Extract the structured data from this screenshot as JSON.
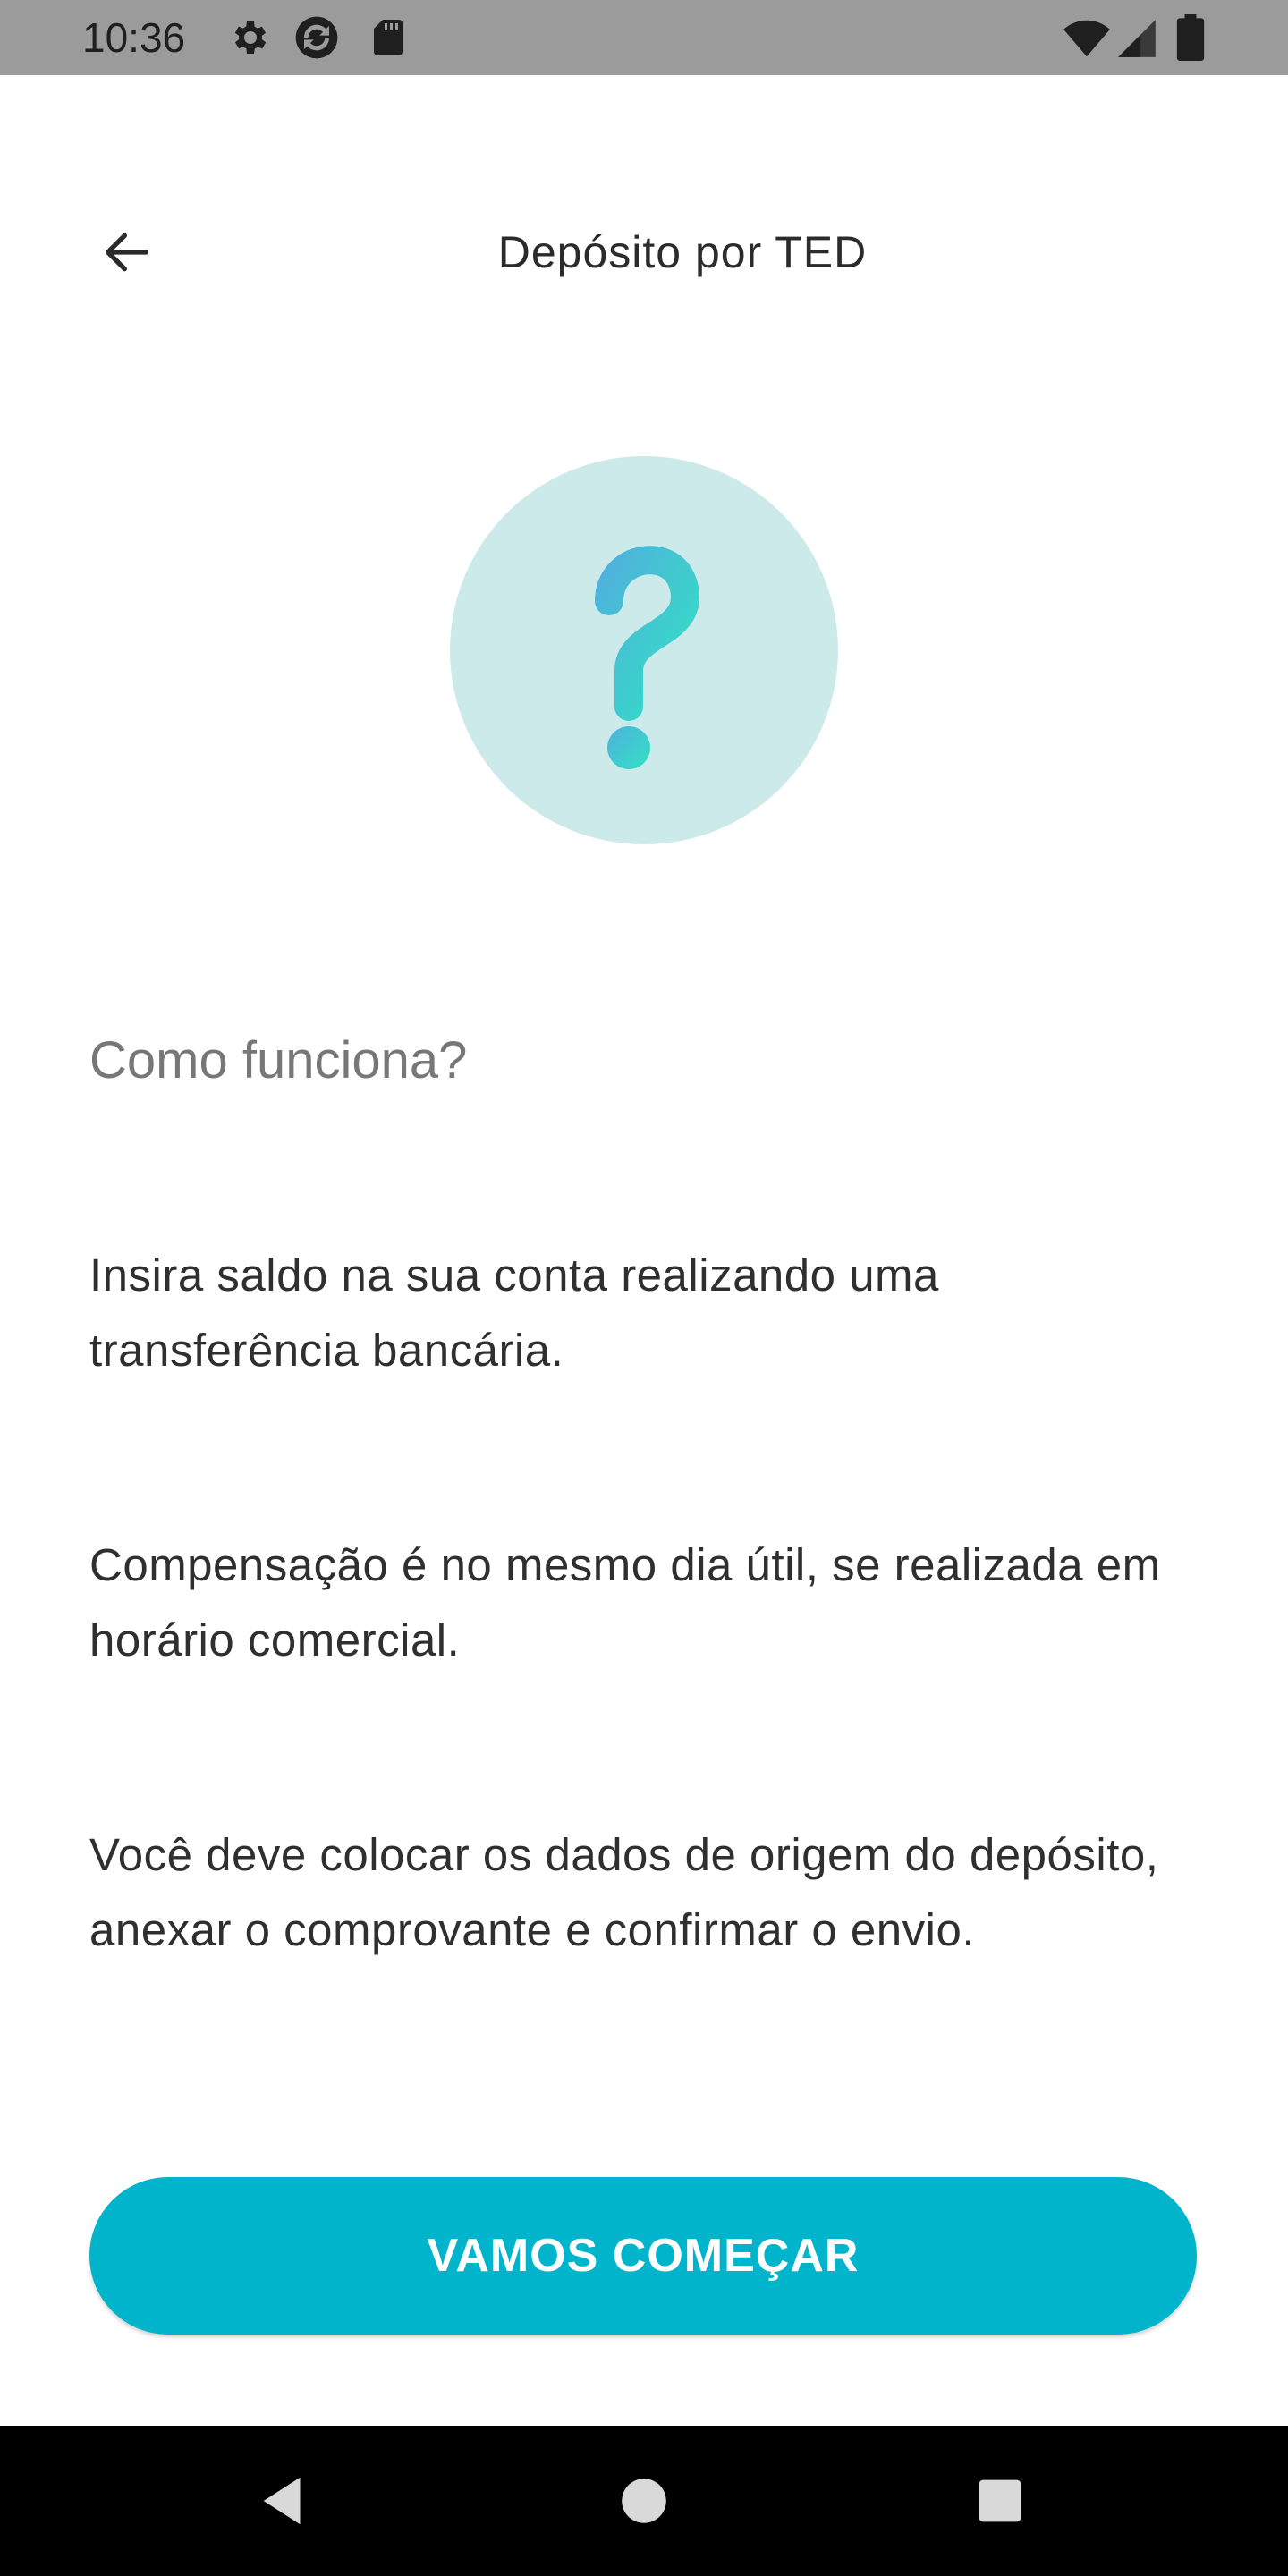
{
  "status_bar": {
    "time": "10:36",
    "icons_left": [
      "settings-icon",
      "sync-icon",
      "sd-card-icon"
    ],
    "icons_right": [
      "wifi-icon",
      "signal-icon",
      "battery-icon"
    ]
  },
  "header": {
    "title": "Depósito por TED",
    "back_icon": "arrow-left-icon"
  },
  "hero": {
    "icon": "question-mark-icon",
    "circle_color": "#cdeaea",
    "gradient_start": "#4fb2dc",
    "gradient_end": "#33e0c4"
  },
  "content": {
    "heading": "Como funciona?",
    "paragraphs": [
      "Insira saldo na sua conta realizando uma transferência bancária.",
      "Compensação é no mesmo dia útil, se realizada em horário comercial.",
      "Você deve colocar os dados de origem do depósito, anexar o comprovante e confirmar o envio."
    ]
  },
  "cta": {
    "label": "VAMOS COMEÇAR",
    "color": "#00b4cc"
  },
  "nav_bar": {
    "buttons": [
      "back-triangle-icon",
      "home-circle-icon",
      "recents-square-icon"
    ]
  }
}
